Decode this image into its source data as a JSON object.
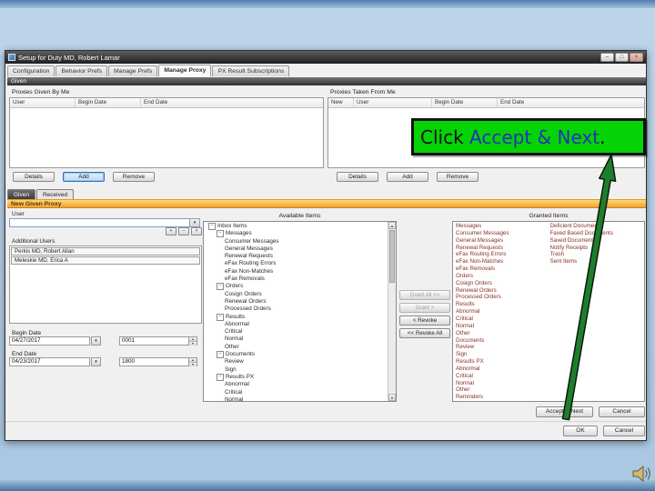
{
  "icons": {
    "minimize": "–",
    "maximize": "□",
    "close": "×",
    "dropdown": "▼",
    "spin_up": "▲",
    "spin_down": "▼",
    "scroll_up": "▲",
    "scroll_down": "▼"
  },
  "slide": {
    "callout_parts": [
      {
        "text": "Click ",
        "color": "#101010"
      },
      {
        "text": "Accept & Next",
        "color": "#2330b8"
      },
      {
        "text": ".",
        "color": "#101010"
      }
    ]
  },
  "window": {
    "title": "Setup for Duty MD, Robert Lamar",
    "tabs": [
      {
        "label": "Configuration"
      },
      {
        "label": "Behavior Prefs"
      },
      {
        "label": "Manage Prefs"
      },
      {
        "label": "Manage Proxy",
        "active": true
      },
      {
        "label": "PX Result Subscriptions"
      }
    ],
    "given_header": "Given",
    "proxies_given": {
      "label": "Proxies Given By Me",
      "columns": [
        "User",
        "Begin Date",
        "End Date"
      ],
      "buttons": [
        {
          "label": "Details"
        },
        {
          "label": "Add",
          "active": true
        },
        {
          "label": "Remove"
        }
      ]
    },
    "proxies_taken": {
      "label": "Proxies Taken From Me",
      "columns": [
        "New",
        "User",
        "Begin Date",
        "End Date"
      ],
      "buttons": [
        {
          "label": "Details"
        },
        {
          "label": "Add"
        },
        {
          "label": "Remove"
        }
      ]
    },
    "sub_tabs": [
      {
        "label": "Given",
        "active": true
      },
      {
        "label": "Received"
      }
    ],
    "new_proxy_header": "New Given Proxy",
    "form": {
      "user_label": "User",
      "user_value": "",
      "user_tools": [
        {
          "glyph": "+"
        },
        {
          "glyph": "−"
        },
        {
          "glyph": "×"
        }
      ],
      "additional_users_label": "Additional Users",
      "additional_users": [
        {
          "name": "Perkis MD, Robert Allan"
        },
        {
          "name": "Meleskie MD, Erica A"
        }
      ],
      "begin_date_label": "Begin Date",
      "begin_date": "04/27/2017",
      "begin_time": "0001",
      "end_date_label": "End Date",
      "end_date": "04/23/2017",
      "end_time": "1800"
    },
    "available": {
      "title": "Available Items",
      "tree": [
        {
          "label": "Inbox Items",
          "level": 0,
          "parent": true
        },
        {
          "label": "Messages",
          "level": 1,
          "parent": true
        },
        {
          "label": "Consumer Messages",
          "level": 2
        },
        {
          "label": "General Messages",
          "level": 2
        },
        {
          "label": "Renewal Requests",
          "level": 2
        },
        {
          "label": "eFax Routing Errors",
          "level": 2
        },
        {
          "label": "eFax Non-Matches",
          "level": 2
        },
        {
          "label": "eFax Removals",
          "level": 2
        },
        {
          "label": "Orders",
          "level": 1,
          "parent": true
        },
        {
          "label": "Cosign Orders",
          "level": 2
        },
        {
          "label": "Renewal Orders",
          "level": 2
        },
        {
          "label": "Processed Orders",
          "level": 2
        },
        {
          "label": "Results",
          "level": 1,
          "parent": true
        },
        {
          "label": "Abnormal",
          "level": 2
        },
        {
          "label": "Critical",
          "level": 2
        },
        {
          "label": "Normal",
          "level": 2
        },
        {
          "label": "Other",
          "level": 2
        },
        {
          "label": "Documents",
          "level": 1,
          "parent": true
        },
        {
          "label": "Review",
          "level": 2
        },
        {
          "label": "Sign",
          "level": 2
        },
        {
          "label": "Results PX",
          "level": 1,
          "parent": true
        },
        {
          "label": "Abnormal",
          "level": 2
        },
        {
          "label": "Critical",
          "level": 2
        },
        {
          "label": "Normal",
          "level": 2
        }
      ]
    },
    "transfer_buttons": [
      {
        "label": "Grant All >>",
        "enabled": false
      },
      {
        "label": "Grant >",
        "enabled": false
      },
      {
        "label": "< Revoke",
        "enabled": true
      },
      {
        "label": "<< Revoke All",
        "enabled": true
      }
    ],
    "granted": {
      "title": "Granted Items",
      "col1": [
        "Messages",
        "Consumer Messages",
        "General Messages",
        "Renewal Requests",
        "eFax Routing Errors",
        "eFax Non-Matches",
        "eFax Removals",
        "Orders",
        "Cosign Orders",
        "Renewal Orders",
        "Processed Orders",
        "Results",
        "Abnormal",
        "Critical",
        "Normal",
        "Other",
        "Documents",
        "Review",
        "Sign",
        "Results PX",
        "Abnormal",
        "Critical",
        "Normal",
        "Other",
        "Reminders"
      ],
      "col2": [
        "Deficient Documents",
        "Faxed Based Documents",
        "Saved Documents",
        "Notify Receipts",
        "Trash",
        "Sent Items"
      ]
    },
    "actions": {
      "accept_next": "Accept & Next",
      "cancel": "Cancel"
    },
    "footer": {
      "ok": "OK",
      "cancel": "Cancel"
    }
  }
}
